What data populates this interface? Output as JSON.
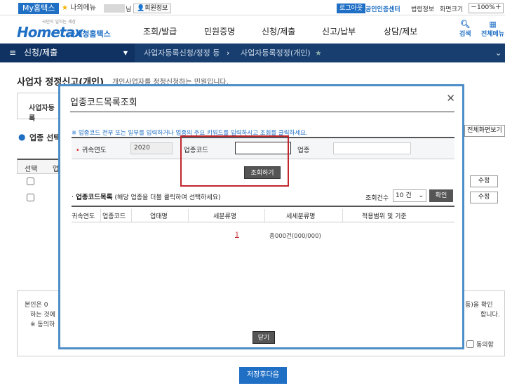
{
  "utility": {
    "my_hometax": "My홈택스",
    "my_menu": "나의메뉴",
    "name_suffix": "님",
    "member_info": "회원정보",
    "logout": "로그아웃",
    "cert_center": "공인인증센터",
    "legal_info": "법령정보",
    "font_size": "화면크기",
    "zoom": "100%"
  },
  "header": {
    "logo_tiny": "국민이 일하는 세상",
    "logo_main": "Hometax",
    "logo_sub": "국세청홈택스",
    "nav": [
      "조회/발급",
      "민원증명",
      "신청/제출",
      "신고/납부",
      "상담/제보"
    ],
    "search": "검색",
    "all_menu": "전체메뉴"
  },
  "navbar": {
    "main": "신청/제출",
    "crumb1": "사업자등록신청/정정 등",
    "crumb2": "사업자등록정정(개인)"
  },
  "page": {
    "title": "사업자 정정신고(개인)",
    "desc": "개인사업자를 정정신청하는 민원입니다.",
    "box_label": "사업자등록",
    "section": "업종 선택",
    "full_view": "전체화면보기",
    "col_select": "선택",
    "col_industry": "업",
    "edit": "수정",
    "agree_text1": "본인은 0",
    "agree_text2": "하는 것에",
    "agree_note": "※ 동의하",
    "agree_right": "등)을 확인",
    "agree_right2": "합니다.",
    "agree_label": "동의함",
    "save_next": "저장후다음"
  },
  "modal": {
    "title": "업종코드목록조회",
    "note": "※ 업종코드 전부 또는 일부를 입력하거나 업종의 주요 키워드를 입력하시고 조회를 클릭하세요.",
    "year_label": "귀속연도",
    "year_value": "2020",
    "code_label": "업종코드",
    "code_value": "",
    "type_label": "업종",
    "search_btn": "조회하기",
    "list_title": "업종코드목록",
    "list_hint": "(해당 업종을 더블 클릭하여 선택하세요)",
    "count_label": "조회건수",
    "count_value": "10 건",
    "ok_btn": "확인",
    "columns": [
      "귀속연도",
      "업종코드",
      "업태명",
      "세분류명",
      "세세분류명",
      "적용범위 및 기준"
    ],
    "page": "1",
    "total": "총000건(000/000)",
    "close_btn": "닫기"
  }
}
